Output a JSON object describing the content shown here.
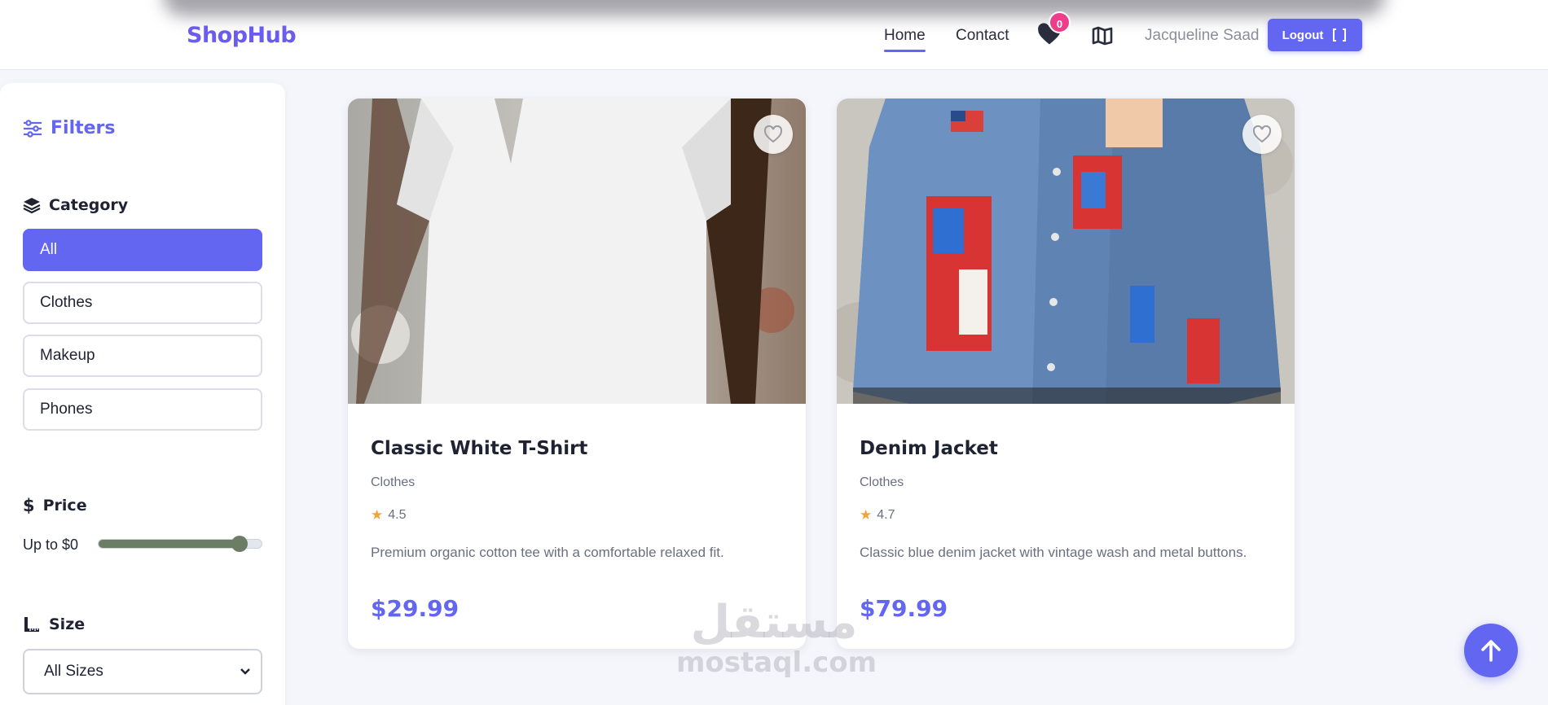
{
  "app": {
    "brand": "ShopHub"
  },
  "header": {
    "nav": {
      "home": "Home",
      "contact": "Contact"
    },
    "wishlist_count": "0",
    "user_name": "Jacqueline Saad",
    "logout_label": "Logout"
  },
  "sidebar": {
    "title": "Filters",
    "category": {
      "title": "Category",
      "items": [
        {
          "label": "All",
          "active": true
        },
        {
          "label": "Clothes",
          "active": false
        },
        {
          "label": "Makeup",
          "active": false
        },
        {
          "label": "Phones",
          "active": false
        }
      ]
    },
    "price": {
      "title": "Price",
      "label": "Up to $0",
      "slider_value": 0.86
    },
    "size": {
      "title": "Size",
      "selected": "All Sizes"
    }
  },
  "products": [
    {
      "name": "Classic White T-Shirt",
      "category": "Clothes",
      "rating": "4.5",
      "description": "Premium organic cotton tee with a comfortable relaxed fit.",
      "price": "$29.99"
    },
    {
      "name": "Denim Jacket",
      "category": "Clothes",
      "rating": "4.7",
      "description": "Classic blue denim jacket with vintage wash and metal buttons.",
      "price": "$79.99"
    }
  ],
  "watermark": {
    "arabic": "مستقل",
    "latin": "mostaql.com"
  },
  "colors": {
    "accent": "#6366f1",
    "brand": "#6b5cf0",
    "badge": "#ee3d8b",
    "star": "#f2a33a",
    "slider": "#6b7d62"
  },
  "icons": {
    "wishlist": "heart-icon",
    "map": "map-icon",
    "logout": "logout-icon",
    "filters": "sliders-icon",
    "category": "layers-icon",
    "price": "dollar-icon",
    "size": "ruler-icon",
    "favorite": "heart-outline-icon",
    "scroll_top": "arrow-up-icon"
  }
}
